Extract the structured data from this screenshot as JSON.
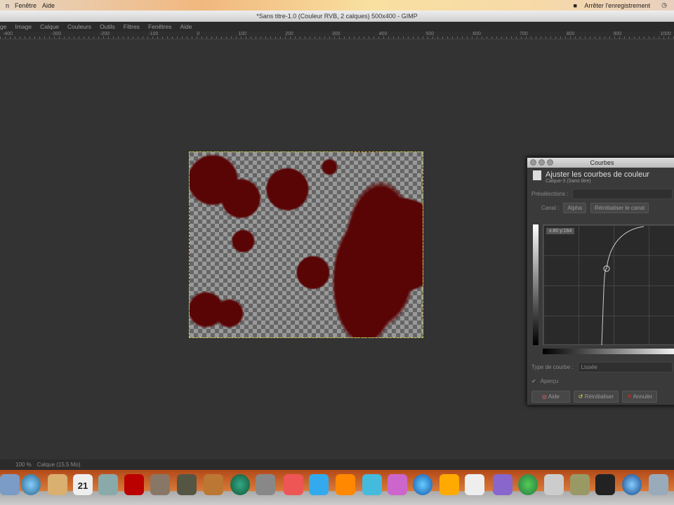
{
  "mac_menubar": {
    "items": [
      "n",
      "Fenêtre",
      "Aide"
    ],
    "recording": "Arrêter l'enregistrement"
  },
  "window": {
    "title": "*Sans titre-1.0 (Couleur RVB, 2 calques) 500x400 - GIMP"
  },
  "menu": [
    "ge",
    "Image",
    "Calque",
    "Couleurs",
    "Outils",
    "Filtres",
    "Fenêtres",
    "Aide"
  ],
  "ruler": [
    "-400",
    "-300",
    "-200",
    "-100",
    "0",
    "100",
    "200",
    "300",
    "400",
    "500",
    "600",
    "700",
    "800",
    "900",
    "1000"
  ],
  "status": {
    "zoom": "100 %",
    "layer": "Calque (15,5 Mo)"
  },
  "curves": {
    "title": "Courbes",
    "heading": "Ajuster les courbes de couleur",
    "subheading": "Calque-3 (Sans titre)",
    "presets_label": "Présélections :",
    "channel_label": "Canal :",
    "channel_value": "Alpha",
    "reset_channel": "Réinitialiser le canal",
    "readout": "x:80 y:164",
    "curve_type_label": "Type de courbe :",
    "curve_type_value": "Lissée",
    "preview_label": "Aperçu",
    "buttons": {
      "help": "Aide",
      "reset": "Réinitialiser",
      "cancel": "Annuler"
    }
  },
  "dock": {
    "calendar_day": "21"
  }
}
